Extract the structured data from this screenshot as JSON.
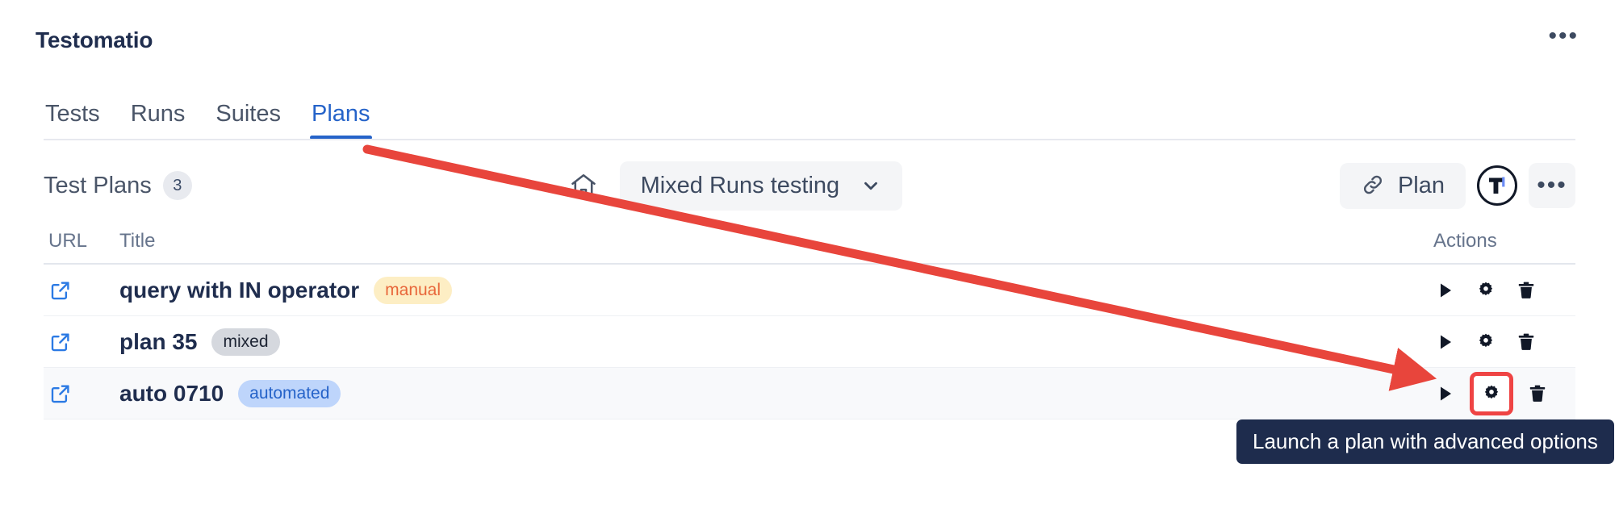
{
  "header": {
    "title": "Testomatio",
    "more_label": "•••"
  },
  "tabs": [
    {
      "label": "Tests",
      "active": false
    },
    {
      "label": "Runs",
      "active": false
    },
    {
      "label": "Suites",
      "active": false
    },
    {
      "label": "Plans",
      "active": true
    }
  ],
  "toolbar": {
    "title": "Test Plans",
    "count": "3",
    "home_icon": "home-icon",
    "project_select": {
      "value": "Mixed Runs testing",
      "chevron_icon": "chevron-down-icon"
    },
    "plan_button": {
      "label": "Plan",
      "icon": "link-icon"
    },
    "logo_badge": "testomatio-logo-icon",
    "more_label": "•••"
  },
  "table": {
    "columns": [
      "URL",
      "Title",
      "Actions"
    ],
    "rows": [
      {
        "url_icon": "external-link-icon",
        "title": "query with IN operator",
        "tag": "manual",
        "tag_kind": "manual",
        "highlight": false,
        "actions": [
          "run-icon",
          "settings-icon",
          "delete-icon"
        ]
      },
      {
        "url_icon": "external-link-icon",
        "title": "plan 35",
        "tag": "mixed",
        "tag_kind": "mixed",
        "highlight": false,
        "actions": [
          "run-icon",
          "settings-icon",
          "delete-icon"
        ]
      },
      {
        "url_icon": "external-link-icon",
        "title": "auto 0710",
        "tag": "automated",
        "tag_kind": "automated",
        "highlight": true,
        "actions": [
          "run-icon",
          "settings-icon",
          "delete-icon"
        ]
      }
    ]
  },
  "tooltip": {
    "text": "Launch a plan with advanced options"
  },
  "annotation": {
    "arrow_color": "#e8453c",
    "highlight_color": "#ef4444"
  },
  "colors": {
    "accent": "#2563c9",
    "title": "#1f2d4e",
    "muted": "#66748c",
    "tooltip_bg": "#1e2c4d",
    "tag_manual_bg": "#fdeec4",
    "tag_manual_fg": "#e8663a",
    "tag_mixed_bg": "#d5d8de",
    "tag_mixed_fg": "#1d2433",
    "tag_automated_bg": "#bed5fb",
    "tag_automated_fg": "#2563c9"
  }
}
